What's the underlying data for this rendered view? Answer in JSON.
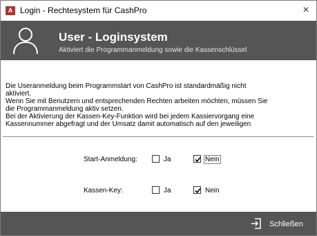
{
  "window": {
    "app_icon": "access-app-icon",
    "app_icon_text": "A",
    "title": "Login - Rechtesystem für CashPro",
    "close_glyph": "×"
  },
  "header": {
    "icon": "user-icon",
    "title": "User - Loginsystem",
    "subtitle": "Aktiviert die Programmanmeldung sowie die Kassenschlüssel",
    "background": "#555555"
  },
  "description": {
    "lines": [
      "Die Useranmeldung beim Programmstart von CashPro ist standardmäßig nicht",
      "aktiviert.",
      "Wenn Sie mit Benutzern und entsprechenden Rechten arbeiten möchten, müssen Sie",
      "die Programmanmeldung aktiv setzen.",
      "Bei der Aktivierung der Kassen-Key-Funktion wird bei jedem Kassiervorgang eine",
      "Kassennummer abgefragt und der Umsatz damit automatisch auf den jeweiligen"
    ]
  },
  "options": {
    "start_anmeldung": {
      "label": "Start-Anmeldung:",
      "ja_label": "Ja",
      "nein_label": "Nein",
      "ja_checked": false,
      "nein_checked": true
    },
    "kassen_key": {
      "label": "Kassen-Key:",
      "ja_label": "Ja",
      "nein_label": "Nein",
      "ja_checked": false,
      "nein_checked": true
    }
  },
  "footer": {
    "close_icon": "exit-icon",
    "close_label": "Schließen",
    "background": "#555555"
  }
}
